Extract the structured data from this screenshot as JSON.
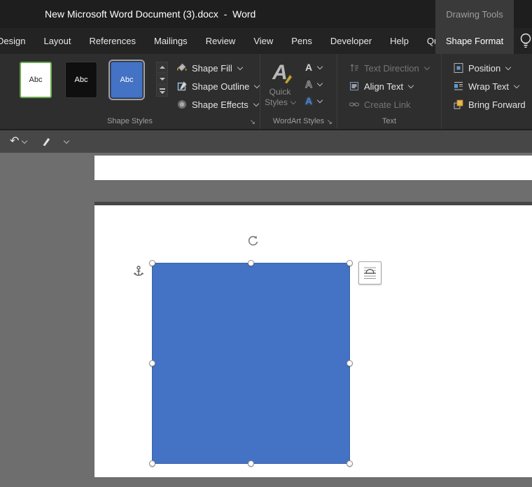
{
  "window": {
    "title": "New Microsoft Word Document (3).docx  -  Word",
    "contextual_tools_label": "Drawing Tools"
  },
  "tabs": [
    "Design",
    "Layout",
    "References",
    "Mailings",
    "Review",
    "View",
    "Pens",
    "Developer",
    "Help",
    "QuillBot",
    "Shape Format"
  ],
  "active_tab": "Shape Format",
  "ribbon": {
    "dialog_launcher_glyph": "↘",
    "shape_styles": {
      "group_label": "Shape Styles",
      "gallery": [
        {
          "label": "Abc",
          "variant": "white-green-border",
          "selected": false
        },
        {
          "label": "Abc",
          "variant": "black",
          "selected": false
        },
        {
          "label": "Abc",
          "variant": "blue",
          "selected": true
        }
      ],
      "shape_fill_label": "Shape Fill",
      "shape_outline_label": "Shape Outline",
      "shape_effects_label": "Shape Effects"
    },
    "wordart_styles": {
      "group_label": "WordArt Styles",
      "quick_styles": {
        "icon_glyph": "A",
        "line1": "Quick",
        "line2": "Styles"
      },
      "text_buttons": [
        {
          "name": "text-fill",
          "glyph": "A"
        },
        {
          "name": "text-outline",
          "glyph": "A"
        },
        {
          "name": "text-effects",
          "glyph": "A"
        }
      ]
    },
    "text_group": {
      "group_label": "Text",
      "text_direction_label": "Text Direction",
      "align_text_label": "Align Text",
      "create_link_label": "Create Link",
      "text_direction_disabled": true,
      "create_link_disabled": true
    },
    "arrange": {
      "position_label": "Position",
      "wrap_text_label": "Wrap Text",
      "bring_forward_label": "Bring Forward"
    }
  },
  "qat": {
    "undo_glyph": "↶"
  },
  "document": {
    "shape": {
      "type": "rectangle",
      "fill": "#4472C4",
      "selected": true,
      "handles": 8
    }
  },
  "colors": {
    "titlebar": "#1E1E1E",
    "ribbon_bg": "#2E2E2E",
    "active_tab_bg": "#3A3A3A",
    "accent_blue": "#4472C4",
    "thumb_green_border": "#6AA84F",
    "page_surround": "#6E6E6E"
  }
}
